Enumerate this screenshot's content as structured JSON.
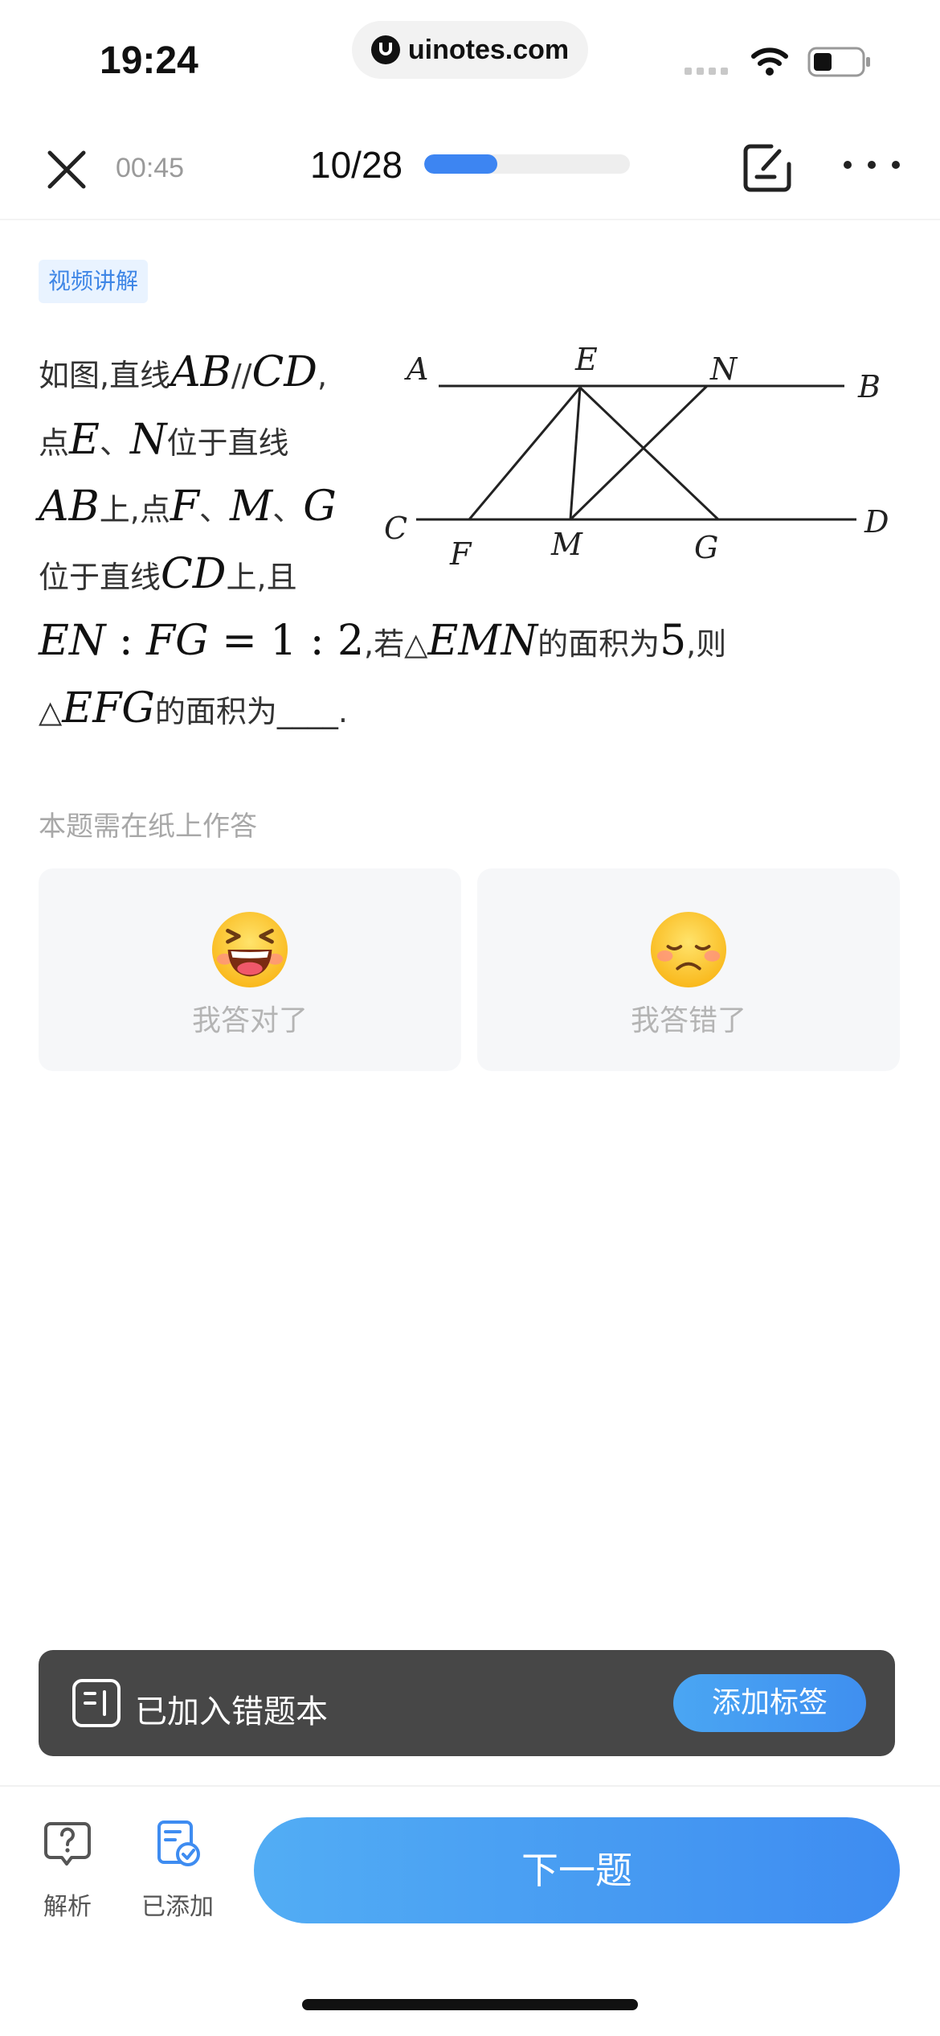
{
  "status_bar": {
    "time": "19:24",
    "url": "uinotes.com",
    "icons": [
      "signal-icon",
      "wifi-icon",
      "battery-icon"
    ]
  },
  "toolbar": {
    "timer": "00:45",
    "progress_text": "10/28",
    "progress_fraction": 0.357,
    "icons": [
      "close-icon",
      "note-edit-icon",
      "more-icon"
    ]
  },
  "question": {
    "tag": "视频讲解",
    "lines": [
      [
        "如图,直线",
        "AB",
        "//",
        "CD",
        ","
      ],
      [
        "点",
        "E",
        "、",
        "N",
        "位于直线"
      ],
      [
        "AB",
        "上,点",
        "F",
        "、",
        "M",
        "、",
        "G"
      ],
      [
        "位于直线",
        "CD",
        "上,且"
      ],
      [
        "EN",
        " : ",
        "FG",
        " = 1 : 2",
        ",若△",
        "EMN",
        "的面积为",
        "5",
        ",则"
      ],
      [
        "△",
        "EFG",
        "的面积为____."
      ]
    ],
    "figure_labels": {
      "A": "A",
      "E": "E",
      "N": "N",
      "B": "B",
      "C": "C",
      "F": "F",
      "M": "M",
      "G": "G",
      "D": "D"
    },
    "paper_hint": "本题需在纸上作答"
  },
  "answers": {
    "correct_label": "我答对了",
    "wrong_label": "我答错了",
    "correct_icon": "laughing-emoji-icon",
    "wrong_icon": "sad-emoji-icon"
  },
  "toast": {
    "text": "已加入错题本",
    "button": "添加标签",
    "icon": "wrong-book-icon"
  },
  "bottom_bar": {
    "analysis_label": "解析",
    "added_label": "已添加",
    "next_label": "下一题"
  },
  "colors": {
    "accent": "#3e8cf1",
    "tag_bg": "#e9f3ff",
    "toast_bg": "#474747",
    "card_bg": "#f6f7f9"
  }
}
